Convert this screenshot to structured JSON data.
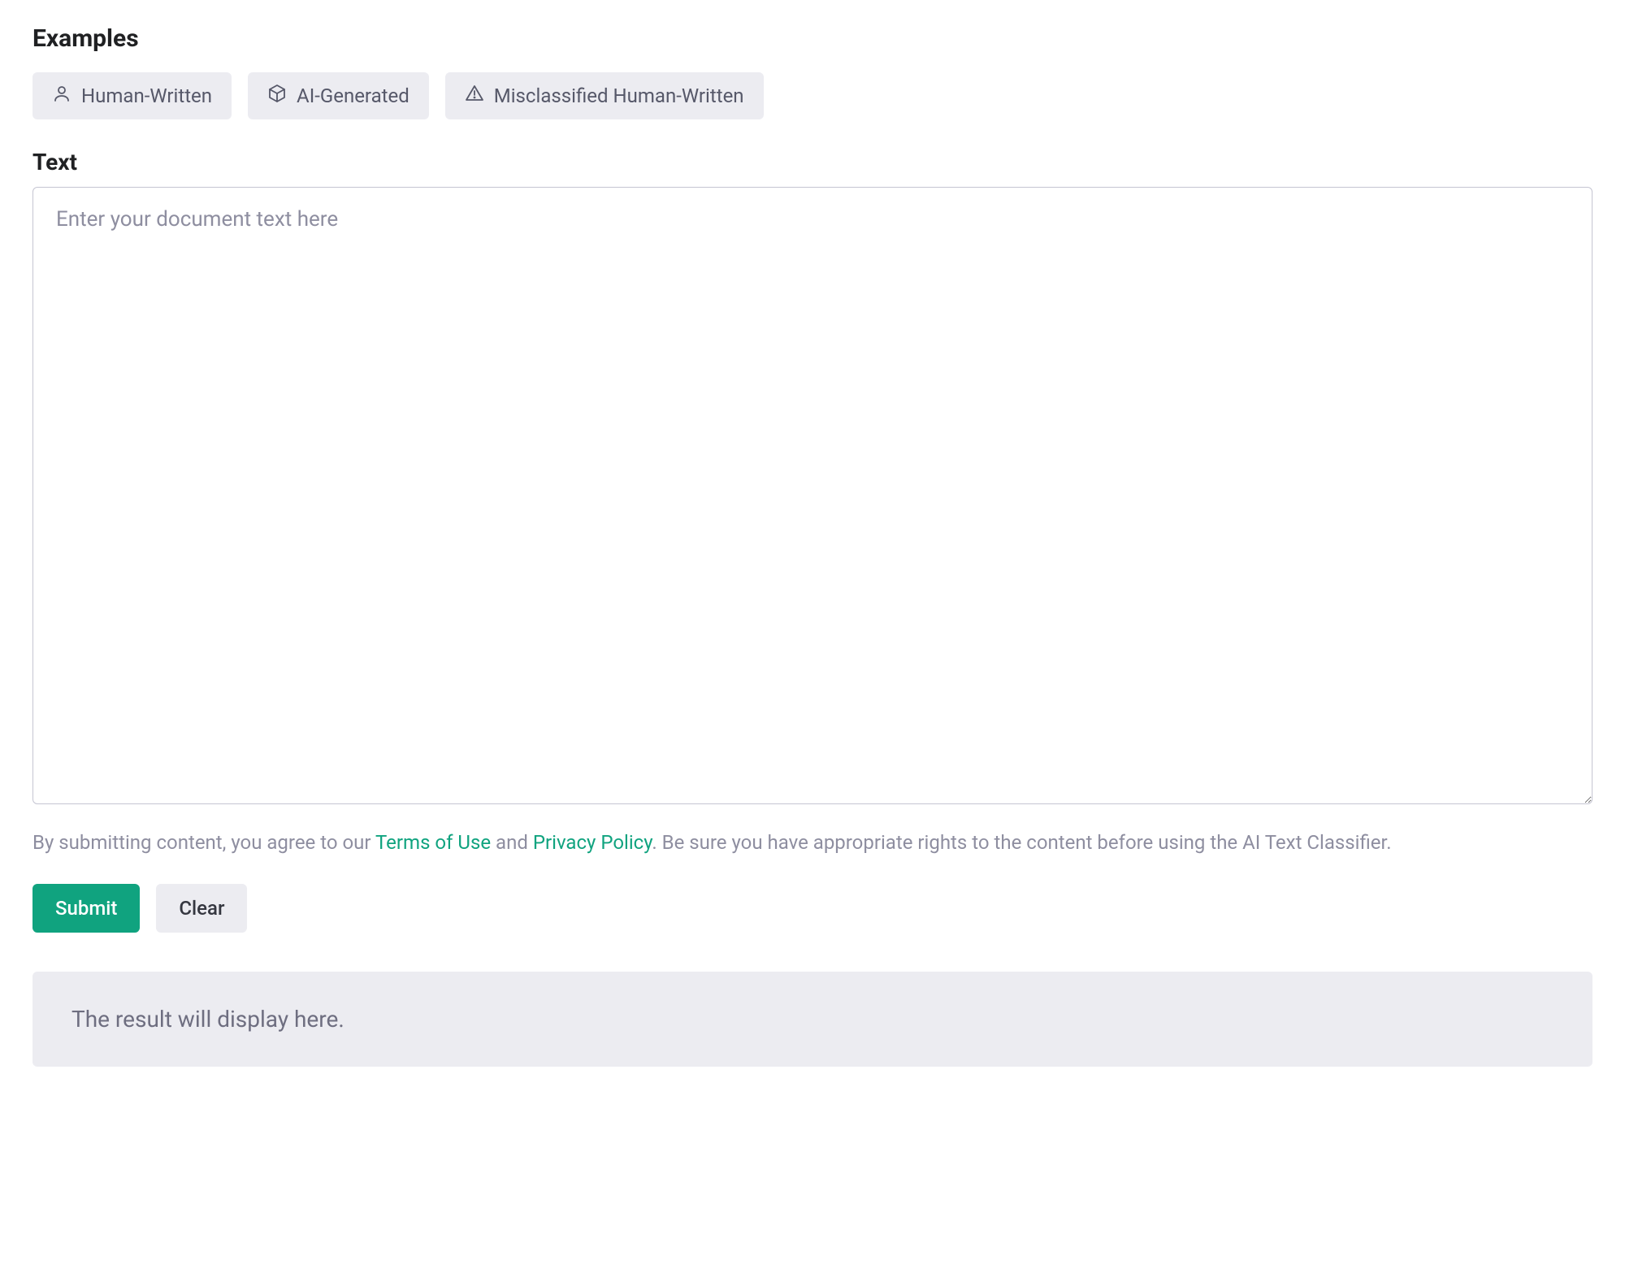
{
  "headings": {
    "examples": "Examples",
    "text": "Text"
  },
  "examples": [
    {
      "label": "Human-Written",
      "icon": "person-icon"
    },
    {
      "label": "AI-Generated",
      "icon": "cube-icon"
    },
    {
      "label": "Misclassified Human-Written",
      "icon": "warning-icon"
    }
  ],
  "textarea": {
    "placeholder": "Enter your document text here",
    "value": ""
  },
  "consent": {
    "prefix": "By submitting content, you agree to our ",
    "terms_label": "Terms of Use",
    "mid1": " and ",
    "privacy_label": "Privacy Policy",
    "suffix": ". Be sure you have appropriate rights to the content before using the AI Text Classifier."
  },
  "actions": {
    "submit": "Submit",
    "clear": "Clear"
  },
  "result": {
    "placeholder": "The result will display here."
  },
  "colors": {
    "accent": "#10a37f",
    "chip_bg": "#ececf1",
    "text_muted": "#8e8ea0"
  }
}
